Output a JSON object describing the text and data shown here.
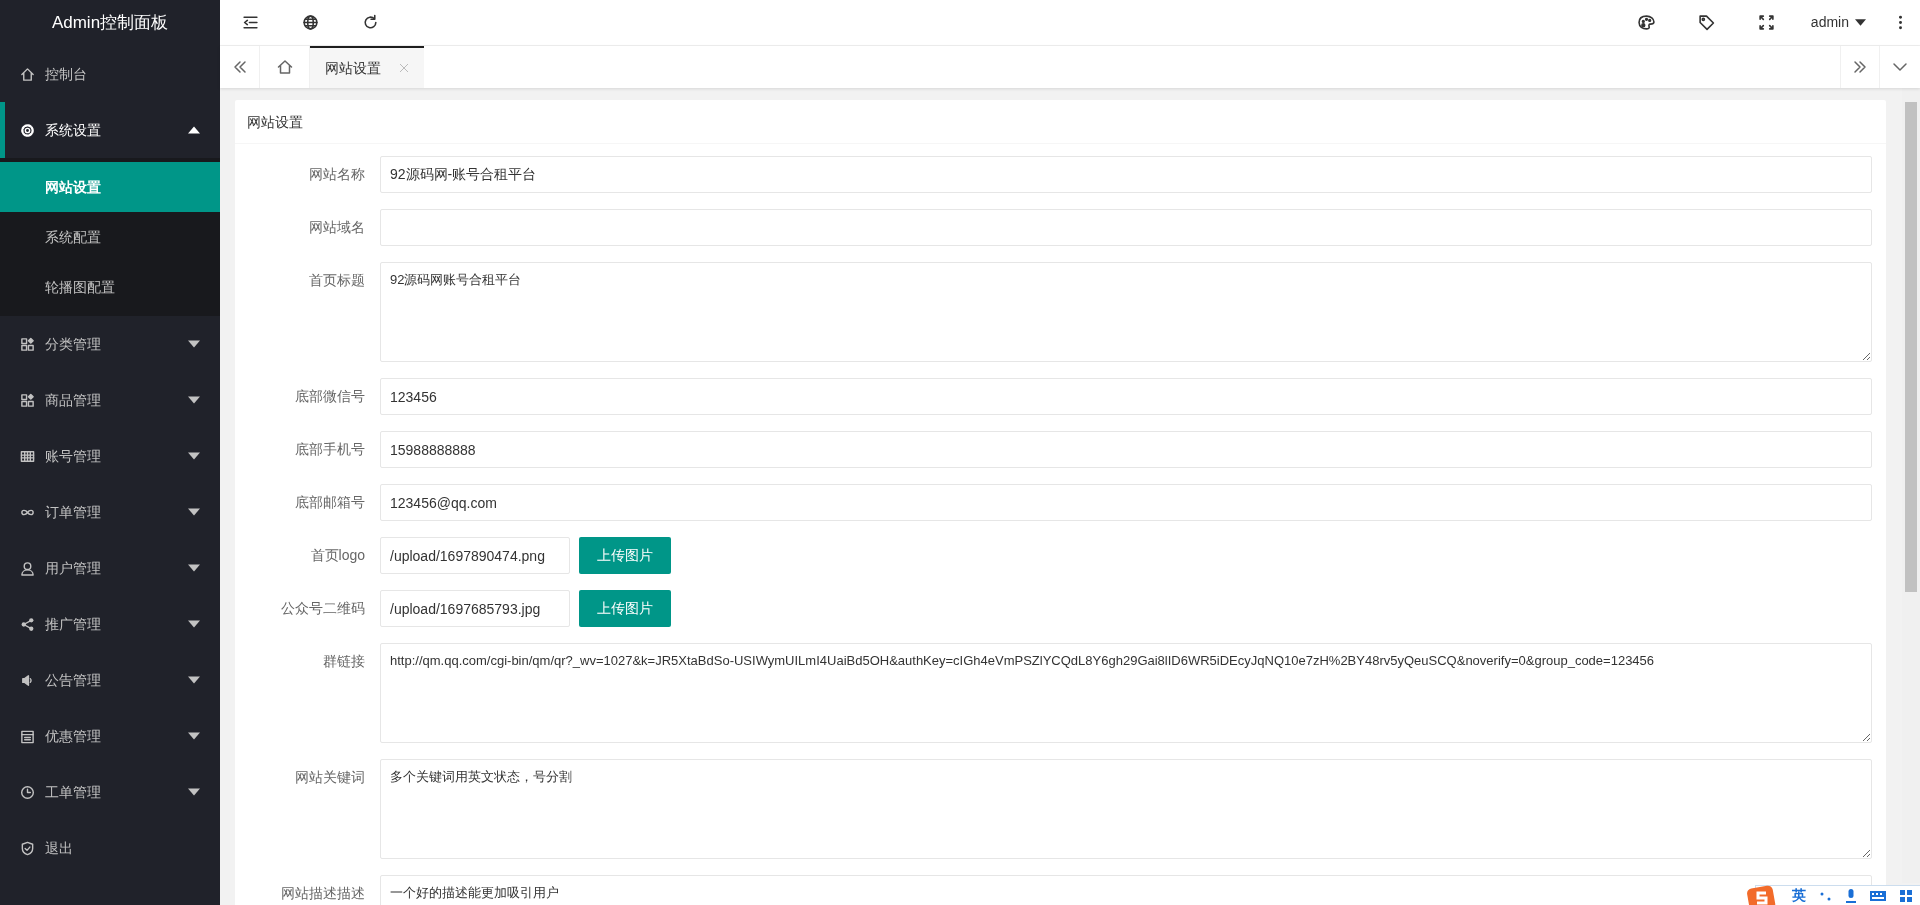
{
  "sidebar": {
    "title": "Admin控制面板",
    "items": [
      {
        "label": "控制台",
        "kind": "link"
      },
      {
        "label": "系统设置",
        "kind": "menu",
        "expanded": true,
        "children": [
          {
            "label": "网站设置",
            "selected": true
          },
          {
            "label": "系统配置",
            "selected": false
          },
          {
            "label": "轮播图配置",
            "selected": false
          }
        ]
      },
      {
        "label": "分类管理",
        "kind": "menu",
        "expanded": false
      },
      {
        "label": "商品管理",
        "kind": "menu",
        "expanded": false
      },
      {
        "label": "账号管理",
        "kind": "menu",
        "expanded": false
      },
      {
        "label": "订单管理",
        "kind": "menu",
        "expanded": false
      },
      {
        "label": "用户管理",
        "kind": "menu",
        "expanded": false
      },
      {
        "label": "推广管理",
        "kind": "menu",
        "expanded": false
      },
      {
        "label": "公告管理",
        "kind": "menu",
        "expanded": false
      },
      {
        "label": "优惠管理",
        "kind": "menu",
        "expanded": false
      },
      {
        "label": "工单管理",
        "kind": "menu",
        "expanded": false
      },
      {
        "label": "退出",
        "kind": "link"
      }
    ]
  },
  "header": {
    "user": "admin"
  },
  "tabs": [
    {
      "label": "网站设置",
      "selected": true
    }
  ],
  "form": {
    "title": "网站设置",
    "fields": [
      {
        "label": "网站名称",
        "kind": "input",
        "value": "92源码网-账号合租平台"
      },
      {
        "label": "网站域名",
        "kind": "input"
      },
      {
        "label": "首页标题",
        "kind": "textarea",
        "value": "92源码网账号合租平台"
      },
      {
        "label": "底部微信号",
        "kind": "input",
        "value": "123456"
      },
      {
        "label": "底部手机号",
        "kind": "input",
        "value": "15988888888"
      },
      {
        "label": "底部邮箱号",
        "kind": "input",
        "value": "123456@qq.com"
      },
      {
        "label": "首页logo",
        "kind": "upload",
        "value": "/upload/1697890474.png",
        "button": "上传图片"
      },
      {
        "label": "公众号二维码",
        "kind": "upload",
        "value": "/upload/1697685793.jpg",
        "button": "上传图片"
      },
      {
        "label": "群链接",
        "kind": "textarea",
        "value": "http://qm.qq.com/cgi-bin/qm/qr?_wv=1027&k=JR5XtaBdSo-USIWymUILmI4UaiBd5OH&authKey=cIGh4eVmPSZlYCQdL8Y6gh29Gai8lID6WR5iDEcyJqNQ10e7zH%2BY48rv5yQeuSCQ&noverify=0&group_code=123456"
      },
      {
        "label": "网站关键词",
        "kind": "textarea",
        "value": "多个关键词用英文状态，号分割"
      },
      {
        "label": "网站描述描述",
        "kind": "textarea",
        "value": "一个好的描述能更加吸引用户"
      }
    ]
  },
  "ime": {
    "mode": "英"
  }
}
